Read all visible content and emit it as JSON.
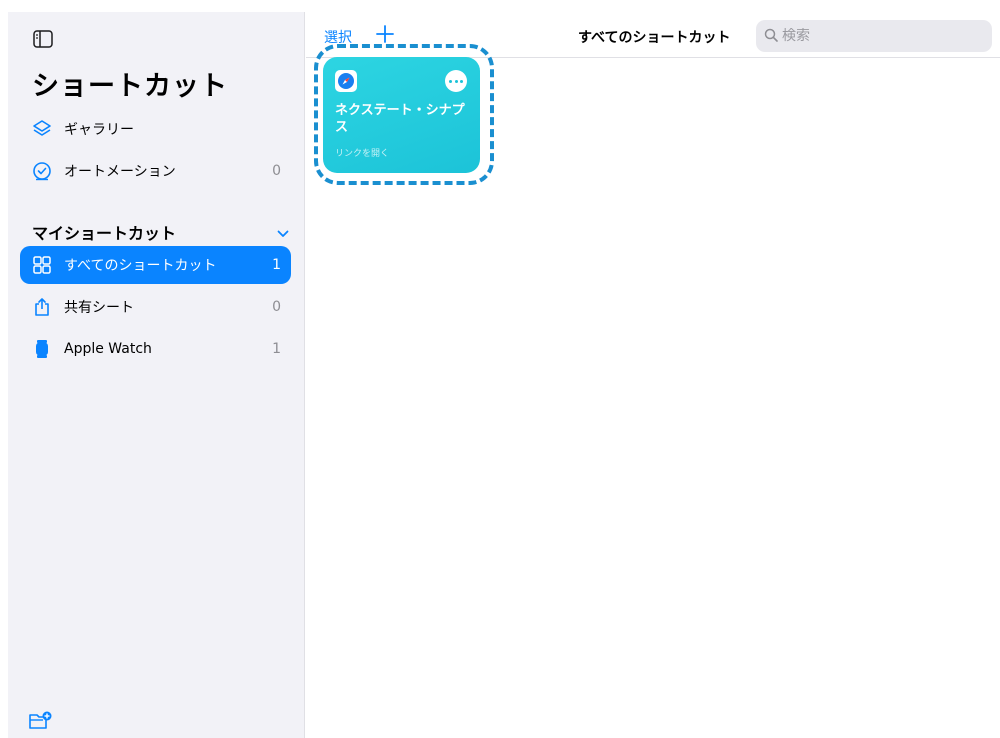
{
  "sidebar": {
    "title": "ショートカット",
    "items": [
      {
        "label": "ギャラリー",
        "count": ""
      },
      {
        "label": "オートメーション",
        "count": "0"
      }
    ],
    "section": {
      "title": "マイショートカット",
      "items": [
        {
          "label": "すべてのショートカット",
          "count": "1"
        },
        {
          "label": "共有シート",
          "count": "0"
        },
        {
          "label": "Apple Watch",
          "count": "1"
        }
      ]
    }
  },
  "toolbar": {
    "select_label": "選択",
    "title": "すべてのショートカット",
    "search_placeholder": "検索"
  },
  "shortcut": {
    "name": "ネクステート・シナプス",
    "action": "リンクを開く"
  },
  "colors": {
    "accent": "#0a84ff",
    "card": "#1cc3d8",
    "highlight": "#1a8fd0"
  }
}
